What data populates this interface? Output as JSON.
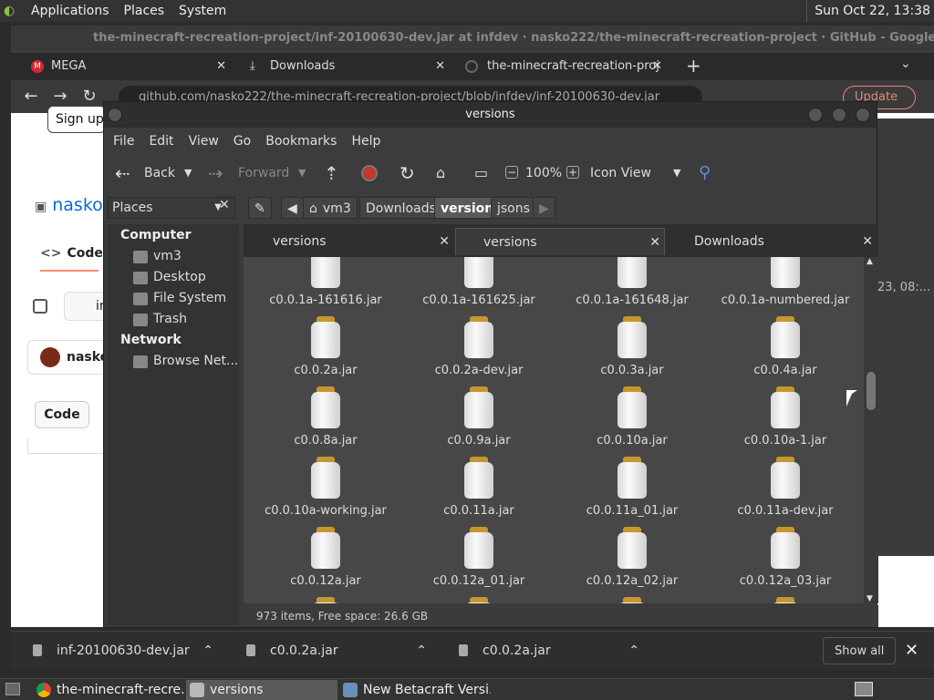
{
  "top_panel": {
    "menus": [
      "Applications",
      "Places",
      "System"
    ],
    "clock": "Sun Oct 22, 13:38"
  },
  "chrome": {
    "window_title": "the-minecraft-recreation-project/inf-20100630-dev.jar at infdev · nasko222/the-minecraft-recreation-project · GitHub - Google Chrome",
    "tabs": [
      {
        "label": "MEGA",
        "icon": "mega-icon"
      },
      {
        "label": "Downloads",
        "icon": "download-icon"
      },
      {
        "label": "the-minecraft-recreation-proj",
        "icon": "github-icon"
      }
    ],
    "url": "github.com/nasko222/the-minecraft-recreation-project/blob/infdev/inf-20100630-dev.jar",
    "update_label": "Update"
  },
  "github": {
    "sign_up": "Sign up",
    "repo": "nasko",
    "code_tab": "Code",
    "branch_text": "in",
    "user": "nasko",
    "code_button": "Code"
  },
  "right_strip": {
    "text": "23, 08:..."
  },
  "nautilus": {
    "title": "versions",
    "menu": [
      "File",
      "Edit",
      "View",
      "Go",
      "Bookmarks",
      "Help"
    ],
    "toolbar": {
      "back": "Back",
      "forward": "Forward",
      "zoom": "100%",
      "view_mode": "Icon View"
    },
    "sidebar_header": "Places",
    "breadcrumbs": [
      "vm3",
      "Downloads",
      "versions",
      "jsons"
    ],
    "breadcrumb_active": "versions",
    "sidebar": {
      "computer_heading": "Computer",
      "computer_items": [
        "vm3",
        "Desktop",
        "File System",
        "Trash"
      ],
      "network_heading": "Network",
      "network_items": [
        "Browse Net..."
      ]
    },
    "tabs": [
      "versions",
      "versions",
      "Downloads"
    ],
    "active_tab": 1,
    "files": [
      "c0.0.1a-161616.jar",
      "c0.0.1a-161625.jar",
      "c0.0.1a-161648.jar",
      "c0.0.1a-numbered.jar",
      "c0.0.2a.jar",
      "c0.0.2a-dev.jar",
      "c0.0.3a.jar",
      "c0.0.4a.jar",
      "c0.0.8a.jar",
      "c0.0.9a.jar",
      "c0.0.10a.jar",
      "c0.0.10a-1.jar",
      "c0.0.10a-working.jar",
      "c0.0.11a.jar",
      "c0.0.11a_01.jar",
      "c0.0.11a-dev.jar",
      "c0.0.12a.jar",
      "c0.0.12a_01.jar",
      "c0.0.12a_02.jar",
      "c0.0.12a_03.jar"
    ],
    "status": "973 items, Free space: 26.6 GB"
  },
  "downloads_shelf": {
    "items": [
      "inf-20100630-dev.jar",
      "c0.0.2a.jar",
      "c0.0.2a.jar"
    ],
    "show_all": "Show all"
  },
  "taskbar": {
    "tasks": [
      "the-minecraft-recre...",
      "versions",
      "New Betacraft Versi..."
    ]
  }
}
